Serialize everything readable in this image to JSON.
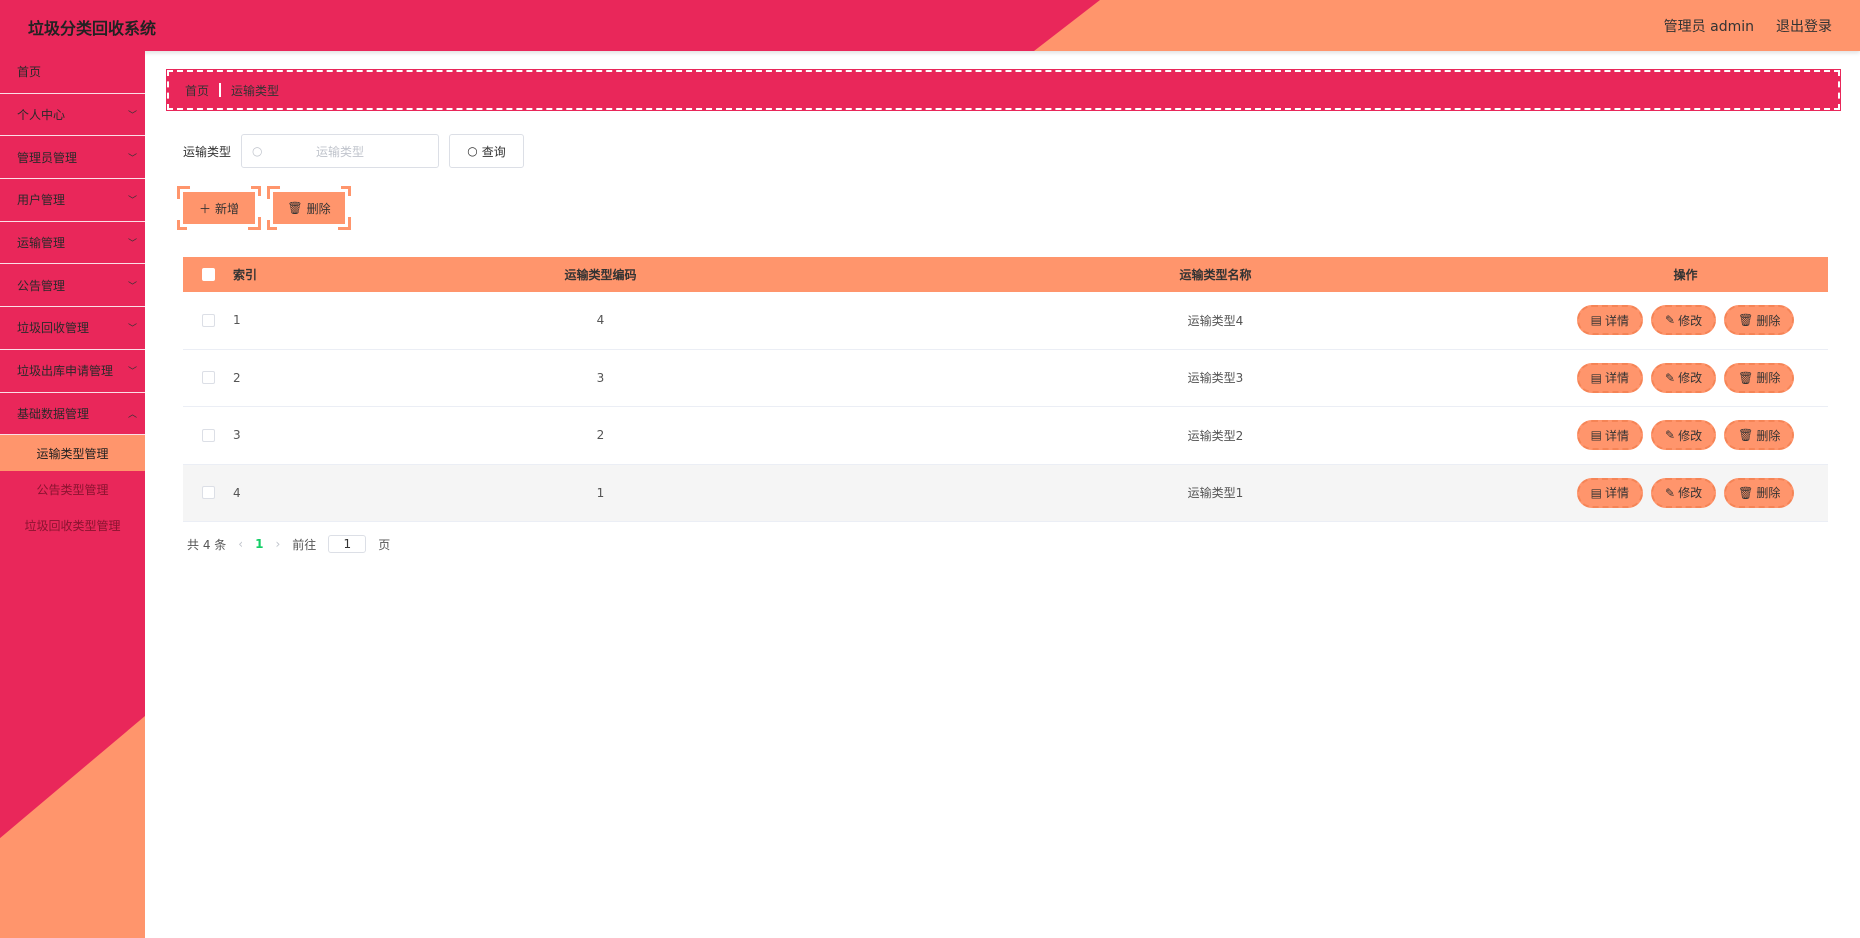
{
  "header": {
    "title": "垃圾分类回收系统",
    "user_label": "管理员 admin",
    "logout_label": "退出登录"
  },
  "sidebar": {
    "items": [
      {
        "label": "首页",
        "has_children": false
      },
      {
        "label": "个人中心",
        "has_children": true
      },
      {
        "label": "管理员管理",
        "has_children": true
      },
      {
        "label": "用户管理",
        "has_children": true
      },
      {
        "label": "运输管理",
        "has_children": true
      },
      {
        "label": "公告管理",
        "has_children": true
      },
      {
        "label": "垃圾回收管理",
        "has_children": true
      },
      {
        "label": "垃圾出库申请管理",
        "has_children": true
      },
      {
        "label": "基础数据管理",
        "has_children": true,
        "expanded": true
      }
    ],
    "sub_items": [
      {
        "label": "运输类型管理",
        "active": true
      },
      {
        "label": "公告类型管理",
        "active": false
      },
      {
        "label": "垃圾回收类型管理",
        "active": false
      }
    ]
  },
  "breadcrumb": {
    "home": "首页",
    "current": "运输类型"
  },
  "search": {
    "label": "运输类型",
    "placeholder": "运输类型",
    "search_button": "查询"
  },
  "actions": {
    "add_label": "新增",
    "delete_label": "删除"
  },
  "table": {
    "columns": [
      "索引",
      "运输类型编码",
      "运输类型名称",
      "操作"
    ],
    "rows": [
      {
        "index": "1",
        "code": "4",
        "name": "运输类型4"
      },
      {
        "index": "2",
        "code": "3",
        "name": "运输类型3"
      },
      {
        "index": "3",
        "code": "2",
        "name": "运输类型2"
      },
      {
        "index": "4",
        "code": "1",
        "name": "运输类型1"
      }
    ],
    "ops": {
      "detail": "详情",
      "edit": "修改",
      "delete": "删除"
    }
  },
  "pagination": {
    "total_text": "共 4 条",
    "current_page": "1",
    "goto_label": "前往",
    "goto_value": "1",
    "page_suffix": "页"
  },
  "colors": {
    "primary": "#e9275a",
    "accent": "#ff956c"
  }
}
